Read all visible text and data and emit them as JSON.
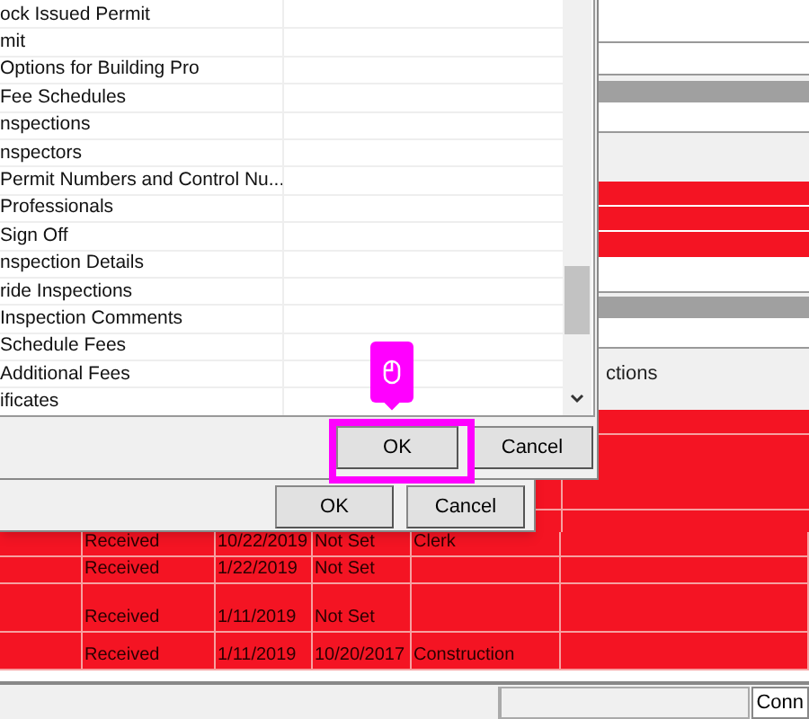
{
  "list": {
    "items": [
      {
        "text": "ock Issued Permit"
      },
      {
        "text": "mit"
      },
      {
        "text": "Options for Building Pro"
      },
      {
        "text": "Fee Schedules"
      },
      {
        "text": "nspections"
      },
      {
        "text": "nspectors"
      },
      {
        "text": "Permit Numbers and Control Nu..."
      },
      {
        "text": "Professionals"
      },
      {
        "text": "Sign Off"
      },
      {
        "text": "nspection Details"
      },
      {
        "text": "ride Inspections"
      },
      {
        "text": "Inspection Comments"
      },
      {
        "text": "Schedule Fees"
      },
      {
        "text": "Additional Fees"
      },
      {
        "text": "ificates"
      }
    ]
  },
  "dialog": {
    "buttons": [
      "OK",
      "Cancel"
    ]
  },
  "outer_dialog": {
    "buttons": [
      "OK",
      "Cancel"
    ]
  },
  "grid": {
    "header": "ctions",
    "rows": [
      {
        "cells": [
          "Received",
          "10/22/2019",
          "Not Set",
          "Clerk"
        ]
      },
      {
        "cells": [
          "Received",
          "1/22/2019",
          "Not Set"
        ]
      },
      {
        "cells": [
          "Received",
          "1/11/2019",
          "Not Set"
        ]
      },
      {
        "cells": [
          "Received",
          "1/11/2019",
          "10/20/2017",
          "Construction"
        ]
      }
    ]
  },
  "status_bar": {
    "panel": "Conn"
  }
}
